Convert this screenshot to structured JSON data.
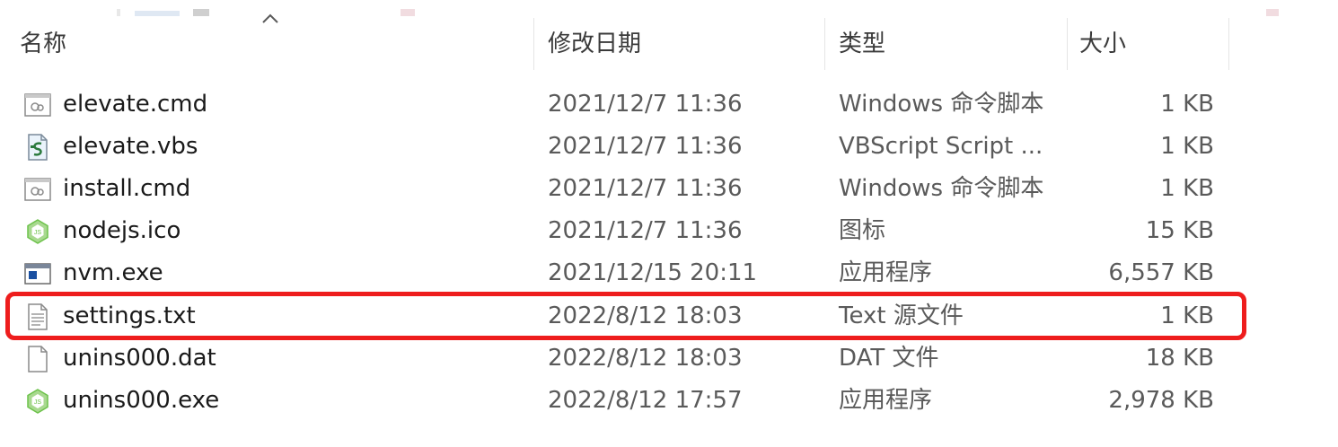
{
  "header": {
    "name": "名称",
    "date": "修改日期",
    "type": "类型",
    "size": "大小"
  },
  "files": [
    {
      "name": "elevate.cmd",
      "date": "2021/12/7 11:36",
      "type": "Windows 命令脚本",
      "size": "1 KB",
      "icon": "cmd-file-icon"
    },
    {
      "name": "elevate.vbs",
      "date": "2021/12/7 11:36",
      "type": "VBScript Script ...",
      "size": "1 KB",
      "icon": "vbs-file-icon"
    },
    {
      "name": "install.cmd",
      "date": "2021/12/7 11:36",
      "type": "Windows 命令脚本",
      "size": "1 KB",
      "icon": "cmd-file-icon"
    },
    {
      "name": "nodejs.ico",
      "date": "2021/12/7 11:36",
      "type": "图标",
      "size": "15 KB",
      "icon": "nodejs-icon"
    },
    {
      "name": "nvm.exe",
      "date": "2021/12/15 20:11",
      "type": "应用程序",
      "size": "6,557 KB",
      "icon": "exe-window-icon"
    },
    {
      "name": "settings.txt",
      "date": "2022/8/12 18:03",
      "type": "Text 源文件",
      "size": "1 KB",
      "icon": "text-file-icon"
    },
    {
      "name": "unins000.dat",
      "date": "2022/8/12 18:03",
      "type": "DAT 文件",
      "size": "18 KB",
      "icon": "blank-file-icon"
    },
    {
      "name": "unins000.exe",
      "date": "2022/8/12 17:57",
      "type": "应用程序",
      "size": "2,978 KB",
      "icon": "nodejs-icon"
    }
  ],
  "highlight": {
    "row_name": "settings.txt",
    "color": "#ee1d1d"
  },
  "colors": {
    "header_text": "#3a3a3a",
    "name_text": "#1a1a1a",
    "detail_text": "#5a5a5a",
    "node_green": "#6cc24a"
  }
}
